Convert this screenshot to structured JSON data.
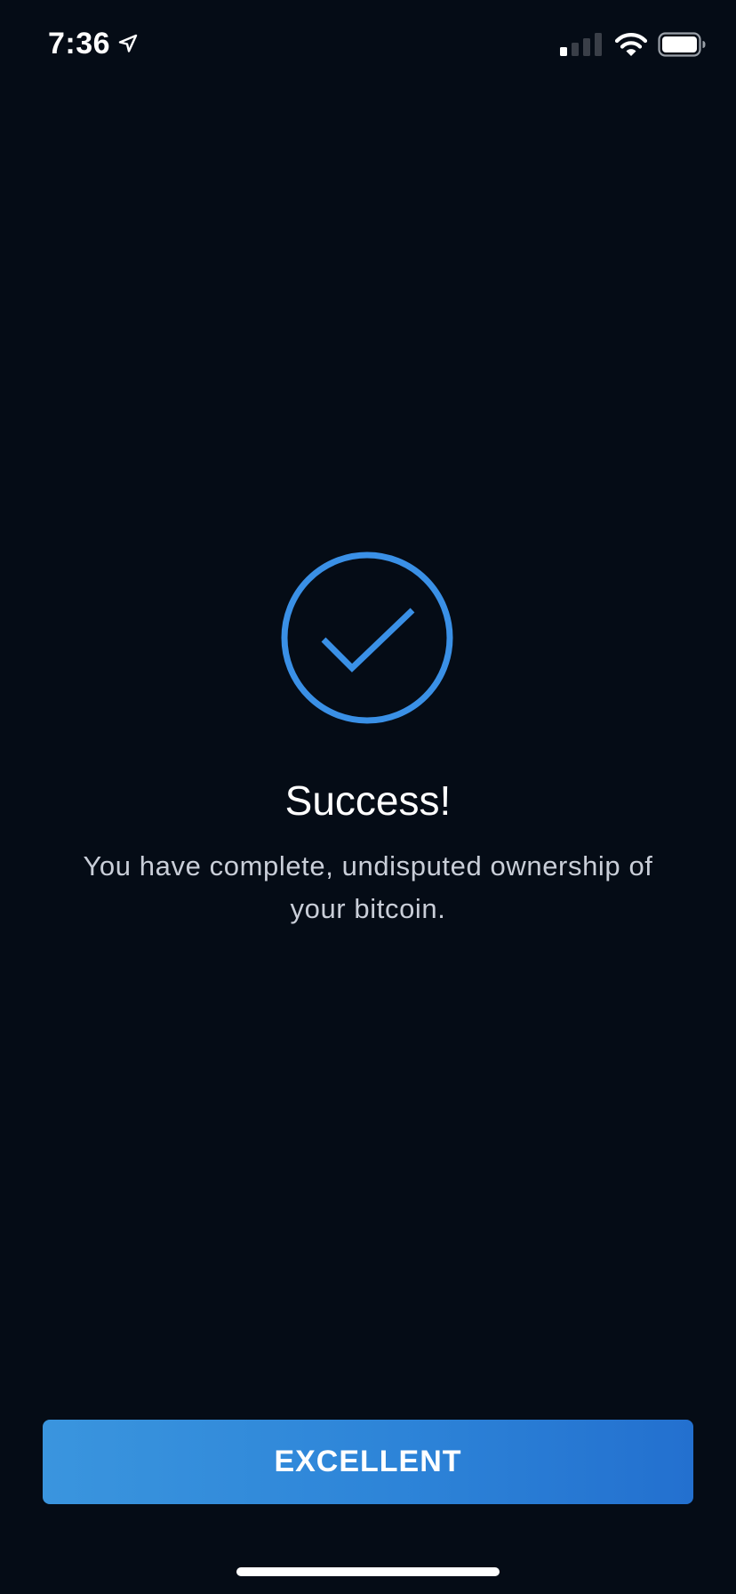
{
  "status_bar": {
    "time": "7:36",
    "location_icon": "location-arrow-icon",
    "signal_icon": "cellular-signal-icon",
    "wifi_icon": "wifi-icon",
    "battery_icon": "battery-icon",
    "signal_bars_active": 1,
    "signal_bars_total": 4,
    "battery_level": 1.0
  },
  "main": {
    "icon": "checkmark-circle-icon",
    "title": "Success!",
    "message": "You have complete, undisputed ownership of your bitcoin."
  },
  "actions": {
    "primary_label": "EXCELLENT"
  },
  "colors": {
    "background": "#050c16",
    "accent": "#3a90e6",
    "button_start": "#3a95de",
    "button_end": "#2370cf",
    "body_text": "#c9ced8"
  }
}
